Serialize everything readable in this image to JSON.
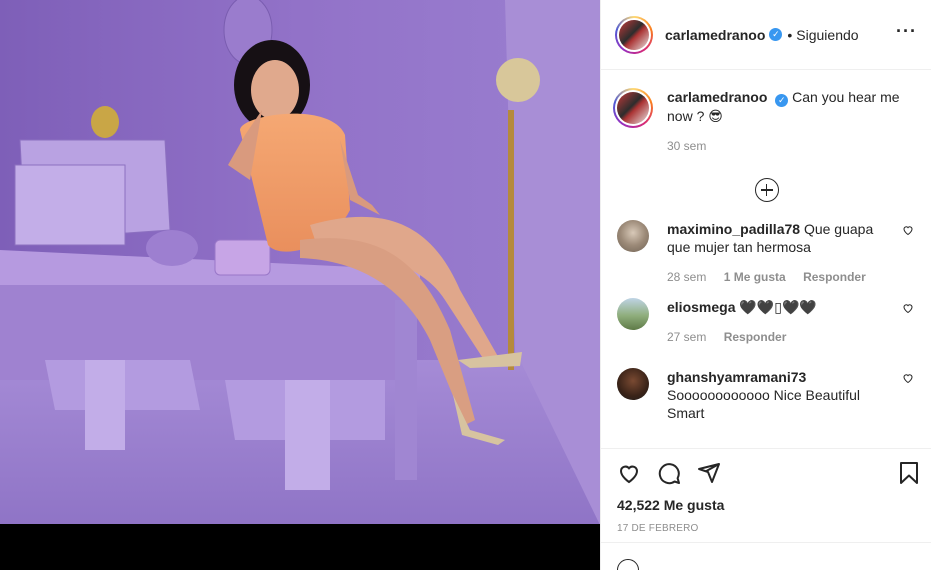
{
  "post": {
    "username": "carlamedranoo",
    "follow_status": "Siguiendo",
    "verified": true
  },
  "caption": {
    "username": "carlamedranoo",
    "text": "Can you hear me now ? 😎",
    "time": "30 sem"
  },
  "comments": [
    {
      "username": "maximino_padilla78",
      "text": "Que guapa que mujer tan hermosa",
      "time": "28 sem",
      "likes": "1 Me gusta",
      "reply_label": "Responder"
    },
    {
      "username": "eliosmega",
      "text": "🖤🖤▯🖤🖤",
      "time": "27 sem",
      "likes": "",
      "reply_label": "Responder"
    },
    {
      "username": "ghanshyamramani73",
      "text": "Soooooooooooo Nice Beautiful Smart",
      "time": "",
      "likes": "",
      "reply_label": ""
    }
  ],
  "stats": {
    "likes": "42,522 Me gusta",
    "date": "17 DE FEBRERO"
  },
  "icons": {
    "more": "more-options-icon",
    "load_more": "plus-circle-icon",
    "like": "heart-icon",
    "comment": "comment-icon",
    "share": "share-icon",
    "save": "bookmark-icon",
    "verified": "verified-badge-icon"
  },
  "colors": {
    "photo_wall": "#8e6bc4",
    "photo_floor": "#9d82cf",
    "dress": "#f0a26c",
    "verified_blue": "#3897f0"
  }
}
